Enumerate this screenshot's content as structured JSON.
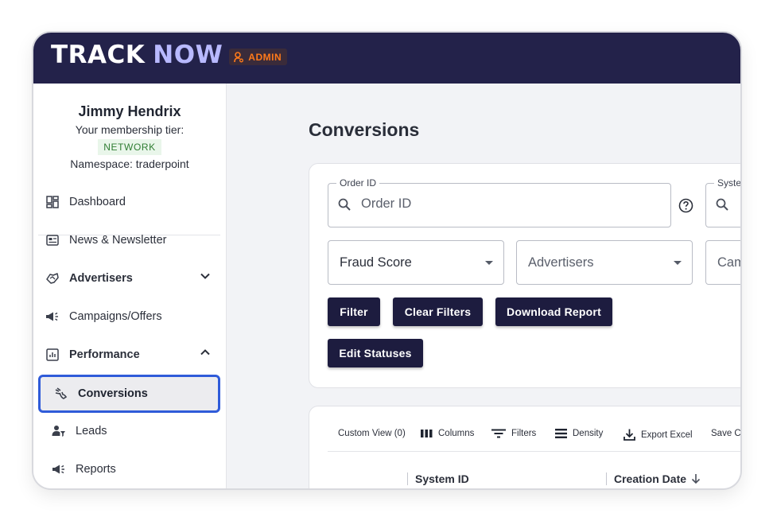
{
  "brand": {
    "name_part1": "TRACK",
    "name_part2": "NOW",
    "role_badge": "ADMIN",
    "accent": "#ff7a1a",
    "topbar_color": "#23224a"
  },
  "profile": {
    "name": "Jimmy Hendrix",
    "tier_label": "Your membership tier:",
    "tier": "NETWORK",
    "namespace": "Namespace: traderpoint"
  },
  "nav": {
    "dashboard": "Dashboard",
    "news": "News & Newsletter",
    "advertisers": "Advertisers",
    "campaigns": "Campaigns/Offers",
    "performance": "Performance",
    "conversions": "Conversions",
    "leads": "Leads",
    "reports": "Reports"
  },
  "page": {
    "title": "Conversions"
  },
  "filters": {
    "order_id_label": "Order ID",
    "order_id_placeholder": "Order ID",
    "system_label": "Syste",
    "fraud_score": "Fraud Score",
    "advertisers": "Advertisers",
    "campaign": "Cam"
  },
  "buttons": {
    "filter": "Filter",
    "clear_filters": "Clear Filters",
    "download_report": "Download Report",
    "edit_statuses": "Edit Statuses"
  },
  "grid_toolbar": {
    "custom_view": "Custom View (0)",
    "columns": "Columns",
    "filters": "Filters",
    "density": "Density",
    "export_excel": "Export Excel",
    "save": "Save C"
  },
  "grid_columns": {
    "system_id": "System ID",
    "creation_date": "Creation Date"
  },
  "active_highlight": "#2f5bd9"
}
